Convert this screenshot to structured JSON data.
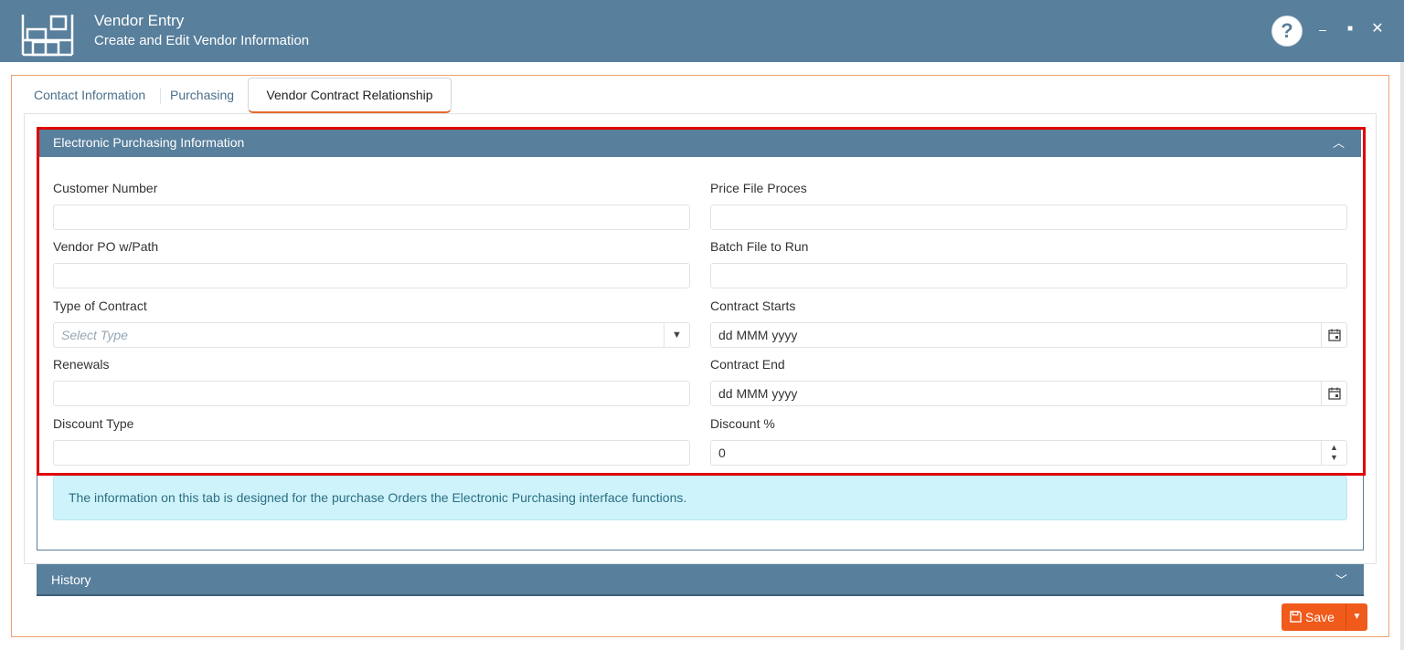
{
  "window": {
    "title": "Vendor Entry",
    "subtitle": "Create and Edit Vendor Information",
    "help_glyph": "?",
    "minimize_glyph": "–",
    "maximize_glyph": "■",
    "close_glyph": "✕"
  },
  "tabs": [
    {
      "label": "Contact Information",
      "active": false
    },
    {
      "label": "Purchasing",
      "active": false
    },
    {
      "label": "Vendor Contract Relationship",
      "active": true
    }
  ],
  "panel": {
    "title": "Electronic Purchasing Information",
    "collapse_icon": "chevron-up-icon",
    "chevron_glyph": "︿"
  },
  "form": {
    "customer_number": {
      "label": "Customer Number",
      "value": ""
    },
    "price_file_proces": {
      "label": "Price File Proces",
      "value": ""
    },
    "vendor_po_path": {
      "label": "Vendor PO w/Path",
      "value": ""
    },
    "batch_file": {
      "label": "Batch File to Run",
      "value": ""
    },
    "contract_type": {
      "label": "Type of Contract",
      "placeholder": "Select Type",
      "arrow_glyph": "▼"
    },
    "contract_starts": {
      "label": "Contract Starts",
      "value": "dd MMM yyyy"
    },
    "renewals": {
      "label": "Renewals",
      "value": ""
    },
    "contract_end": {
      "label": "Contract End",
      "value": "dd MMM yyyy"
    },
    "discount_type": {
      "label": "Discount Type",
      "value": ""
    },
    "discount_pct": {
      "label": "Discount %",
      "value": "0",
      "up_glyph": "▲",
      "down_glyph": "▼"
    }
  },
  "info_message": "The information on this tab is designed for the purchase Orders the Electronic Purchasing interface functions.",
  "history": {
    "title": "History",
    "chevron_glyph": "﹀"
  },
  "save": {
    "label": "Save",
    "dropdown_glyph": "▼"
  },
  "colors": {
    "header": "#587f9c",
    "accent": "#f05a1b",
    "highlight": "#e00000",
    "info_bg": "#cff3fb"
  }
}
